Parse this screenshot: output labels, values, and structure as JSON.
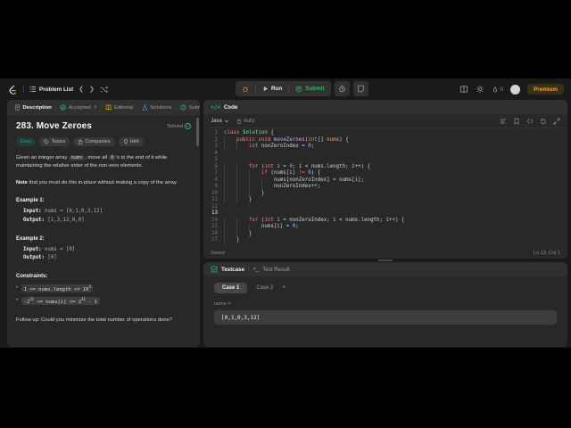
{
  "navbar": {
    "problem_list_label": "Problem List",
    "run_label": "Run",
    "submit_label": "Submit",
    "streak_count": "0",
    "premium_label": "Premium"
  },
  "description_panel": {
    "tabs": [
      {
        "label": "Description"
      },
      {
        "label": "Accepted"
      },
      {
        "label": "Editorial"
      },
      {
        "label": "Solutions"
      },
      {
        "label": "Submissions"
      }
    ],
    "title": "283. Move Zeroes",
    "solved_label": "Solved",
    "solved_check": "✓",
    "tags": {
      "difficulty": "Easy",
      "topics": "Topics",
      "companies": "Companies",
      "hint": "Hint"
    },
    "intro": {
      "p1": "Given an integer array ",
      "code1": "nums",
      "p2": ", move all ",
      "code2": "0",
      "p3": "'s to the end of it while maintaining the relative order of the non-zero elements."
    },
    "note": {
      "bold": "Note",
      "rest": " that you must do this in-place without making a copy of the array."
    },
    "example1": {
      "heading": "Example 1:",
      "input_label": "Input:",
      "input_value": " nums = [0,1,0,3,12]",
      "output_label": "Output:",
      "output_value": " [1,3,12,0,0]"
    },
    "example2": {
      "heading": "Example 2:",
      "input_label": "Input:",
      "input_value": " nums = [0]",
      "output_label": "Output:",
      "output_value": " [0]"
    },
    "constraints_heading": "Constraints:",
    "constraints": [
      [
        {
          "t": "c",
          "v": "1 <= nums.length <= 10"
        },
        {
          "t": "s",
          "v": "4"
        }
      ],
      [
        {
          "t": "c",
          "v": "-2"
        },
        {
          "t": "s",
          "v": "31"
        },
        {
          "t": "c",
          "v": " <= nums[i] <= 2"
        },
        {
          "t": "s",
          "v": "31"
        },
        {
          "t": "c",
          "v": " - 1"
        }
      ]
    ],
    "followup_partial": "Follow up: Could you minimize the total number of operations done?"
  },
  "code_panel": {
    "header_label": "Code",
    "code_glyph": "</>",
    "language": "Java",
    "auto_label": "Auto",
    "saved_label": "Saved",
    "cursor_position": "Ln 13, Col 1",
    "cursor_line": 13,
    "code_lines": [
      [
        [
          "k",
          "class"
        ],
        [
          "p",
          " "
        ],
        [
          "t",
          "Solution"
        ],
        [
          "p",
          " {"
        ]
      ],
      [
        [
          "p",
          "    "
        ],
        [
          "k",
          "public"
        ],
        [
          "p",
          " "
        ],
        [
          "k",
          "void"
        ],
        [
          "p",
          " "
        ],
        [
          "f",
          "moveZeroes"
        ],
        [
          "p",
          "("
        ],
        [
          "k",
          "int"
        ],
        [
          "p",
          "[] "
        ],
        [
          "a",
          "nums"
        ],
        [
          "p",
          ") {"
        ]
      ],
      [
        [
          "p",
          "        "
        ],
        [
          "k",
          "int"
        ],
        [
          "p",
          " nonZeroIndex = "
        ],
        [
          "n",
          "0"
        ],
        [
          "p",
          ";"
        ]
      ],
      [],
      [],
      [
        [
          "p",
          "        "
        ],
        [
          "k",
          "for"
        ],
        [
          "p",
          " ("
        ],
        [
          "k",
          "int"
        ],
        [
          "p",
          " i = "
        ],
        [
          "n",
          "0"
        ],
        [
          "p",
          "; i < nums.length; i++) {"
        ]
      ],
      [
        [
          "p",
          "            "
        ],
        [
          "k",
          "if"
        ],
        [
          "p",
          " (nums[i] "
        ],
        [
          "o",
          "!="
        ],
        [
          "p",
          " "
        ],
        [
          "n",
          "0"
        ],
        [
          "p",
          ") {"
        ]
      ],
      [
        [
          "p",
          "                nums[nonZeroIndex] = nums[i];"
        ]
      ],
      [
        [
          "p",
          "                nonZeroIndex++;"
        ]
      ],
      [
        [
          "p",
          "            }"
        ]
      ],
      [
        [
          "p",
          "        }"
        ]
      ],
      [],
      [],
      [
        [
          "p",
          "        "
        ],
        [
          "k",
          "for"
        ],
        [
          "p",
          " ("
        ],
        [
          "k",
          "int"
        ],
        [
          "p",
          " i = nonZeroIndex; i < nums.length; i++) {"
        ]
      ],
      [
        [
          "p",
          "            nums[i] = "
        ],
        [
          "n",
          "0"
        ],
        [
          "p",
          ";"
        ]
      ],
      [
        [
          "p",
          "        }"
        ]
      ],
      [
        [
          "p",
          "    }"
        ]
      ]
    ]
  },
  "testcase_panel": {
    "testcase_label": "Testcase",
    "test_result_label": "Test Result",
    "terminal_glyph": ">_",
    "case1_label": "Case 1",
    "case2_label": "Case 2",
    "add_case_label": "+",
    "param_label": "nums =",
    "input_value": "[0,1,0,3,12]"
  },
  "colors": {
    "green": "#2cbb5d",
    "easy_teal": "#00b8a3",
    "orange": "#ffa116",
    "keyword": "#ff7b72"
  }
}
